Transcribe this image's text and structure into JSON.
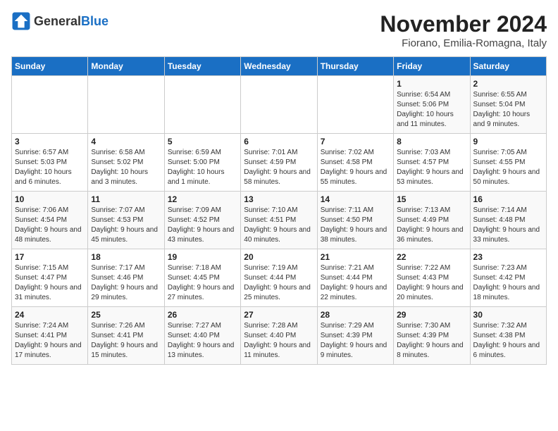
{
  "header": {
    "logo_general": "General",
    "logo_blue": "Blue",
    "month_year": "November 2024",
    "location": "Fiorano, Emilia-Romagna, Italy"
  },
  "weekdays": [
    "Sunday",
    "Monday",
    "Tuesday",
    "Wednesday",
    "Thursday",
    "Friday",
    "Saturday"
  ],
  "weeks": [
    [
      {
        "day": "",
        "info": ""
      },
      {
        "day": "",
        "info": ""
      },
      {
        "day": "",
        "info": ""
      },
      {
        "day": "",
        "info": ""
      },
      {
        "day": "",
        "info": ""
      },
      {
        "day": "1",
        "info": "Sunrise: 6:54 AM\nSunset: 5:06 PM\nDaylight: 10 hours and 11 minutes."
      },
      {
        "day": "2",
        "info": "Sunrise: 6:55 AM\nSunset: 5:04 PM\nDaylight: 10 hours and 9 minutes."
      }
    ],
    [
      {
        "day": "3",
        "info": "Sunrise: 6:57 AM\nSunset: 5:03 PM\nDaylight: 10 hours and 6 minutes."
      },
      {
        "day": "4",
        "info": "Sunrise: 6:58 AM\nSunset: 5:02 PM\nDaylight: 10 hours and 3 minutes."
      },
      {
        "day": "5",
        "info": "Sunrise: 6:59 AM\nSunset: 5:00 PM\nDaylight: 10 hours and 1 minute."
      },
      {
        "day": "6",
        "info": "Sunrise: 7:01 AM\nSunset: 4:59 PM\nDaylight: 9 hours and 58 minutes."
      },
      {
        "day": "7",
        "info": "Sunrise: 7:02 AM\nSunset: 4:58 PM\nDaylight: 9 hours and 55 minutes."
      },
      {
        "day": "8",
        "info": "Sunrise: 7:03 AM\nSunset: 4:57 PM\nDaylight: 9 hours and 53 minutes."
      },
      {
        "day": "9",
        "info": "Sunrise: 7:05 AM\nSunset: 4:55 PM\nDaylight: 9 hours and 50 minutes."
      }
    ],
    [
      {
        "day": "10",
        "info": "Sunrise: 7:06 AM\nSunset: 4:54 PM\nDaylight: 9 hours and 48 minutes."
      },
      {
        "day": "11",
        "info": "Sunrise: 7:07 AM\nSunset: 4:53 PM\nDaylight: 9 hours and 45 minutes."
      },
      {
        "day": "12",
        "info": "Sunrise: 7:09 AM\nSunset: 4:52 PM\nDaylight: 9 hours and 43 minutes."
      },
      {
        "day": "13",
        "info": "Sunrise: 7:10 AM\nSunset: 4:51 PM\nDaylight: 9 hours and 40 minutes."
      },
      {
        "day": "14",
        "info": "Sunrise: 7:11 AM\nSunset: 4:50 PM\nDaylight: 9 hours and 38 minutes."
      },
      {
        "day": "15",
        "info": "Sunrise: 7:13 AM\nSunset: 4:49 PM\nDaylight: 9 hours and 36 minutes."
      },
      {
        "day": "16",
        "info": "Sunrise: 7:14 AM\nSunset: 4:48 PM\nDaylight: 9 hours and 33 minutes."
      }
    ],
    [
      {
        "day": "17",
        "info": "Sunrise: 7:15 AM\nSunset: 4:47 PM\nDaylight: 9 hours and 31 minutes."
      },
      {
        "day": "18",
        "info": "Sunrise: 7:17 AM\nSunset: 4:46 PM\nDaylight: 9 hours and 29 minutes."
      },
      {
        "day": "19",
        "info": "Sunrise: 7:18 AM\nSunset: 4:45 PM\nDaylight: 9 hours and 27 minutes."
      },
      {
        "day": "20",
        "info": "Sunrise: 7:19 AM\nSunset: 4:44 PM\nDaylight: 9 hours and 25 minutes."
      },
      {
        "day": "21",
        "info": "Sunrise: 7:21 AM\nSunset: 4:44 PM\nDaylight: 9 hours and 22 minutes."
      },
      {
        "day": "22",
        "info": "Sunrise: 7:22 AM\nSunset: 4:43 PM\nDaylight: 9 hours and 20 minutes."
      },
      {
        "day": "23",
        "info": "Sunrise: 7:23 AM\nSunset: 4:42 PM\nDaylight: 9 hours and 18 minutes."
      }
    ],
    [
      {
        "day": "24",
        "info": "Sunrise: 7:24 AM\nSunset: 4:41 PM\nDaylight: 9 hours and 17 minutes."
      },
      {
        "day": "25",
        "info": "Sunrise: 7:26 AM\nSunset: 4:41 PM\nDaylight: 9 hours and 15 minutes."
      },
      {
        "day": "26",
        "info": "Sunrise: 7:27 AM\nSunset: 4:40 PM\nDaylight: 9 hours and 13 minutes."
      },
      {
        "day": "27",
        "info": "Sunrise: 7:28 AM\nSunset: 4:40 PM\nDaylight: 9 hours and 11 minutes."
      },
      {
        "day": "28",
        "info": "Sunrise: 7:29 AM\nSunset: 4:39 PM\nDaylight: 9 hours and 9 minutes."
      },
      {
        "day": "29",
        "info": "Sunrise: 7:30 AM\nSunset: 4:39 PM\nDaylight: 9 hours and 8 minutes."
      },
      {
        "day": "30",
        "info": "Sunrise: 7:32 AM\nSunset: 4:38 PM\nDaylight: 9 hours and 6 minutes."
      }
    ]
  ]
}
